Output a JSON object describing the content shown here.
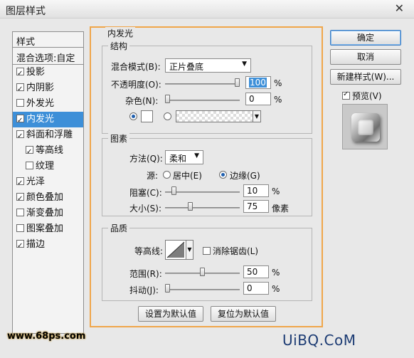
{
  "window": {
    "title": "图层样式"
  },
  "styles": {
    "header": "样式",
    "blend_options": "混合选项:自定",
    "items": [
      {
        "label": "投影",
        "checked": true,
        "sub": false,
        "active": false
      },
      {
        "label": "内阴影",
        "checked": true,
        "sub": false,
        "active": false
      },
      {
        "label": "外发光",
        "checked": false,
        "sub": false,
        "active": false
      },
      {
        "label": "内发光",
        "checked": true,
        "sub": false,
        "active": true
      },
      {
        "label": "斜面和浮雕",
        "checked": true,
        "sub": false,
        "active": false
      },
      {
        "label": "等高线",
        "checked": true,
        "sub": true,
        "active": false
      },
      {
        "label": "纹理",
        "checked": false,
        "sub": true,
        "active": false
      },
      {
        "label": "光泽",
        "checked": true,
        "sub": false,
        "active": false
      },
      {
        "label": "颜色叠加",
        "checked": true,
        "sub": false,
        "active": false
      },
      {
        "label": "渐变叠加",
        "checked": false,
        "sub": false,
        "active": false
      },
      {
        "label": "图案叠加",
        "checked": false,
        "sub": false,
        "active": false
      },
      {
        "label": "描边",
        "checked": true,
        "sub": false,
        "active": false
      }
    ]
  },
  "inner_glow": {
    "section_title": "内发光",
    "structure": {
      "title": "结构",
      "blend_mode_label": "混合模式(B):",
      "blend_mode_value": "正片叠底",
      "opacity_label": "不透明度(O):",
      "opacity_value": "100",
      "opacity_unit": "%",
      "noise_label": "杂色(N):",
      "noise_value": "0",
      "noise_unit": "%"
    },
    "elements": {
      "title": "图素",
      "method_label": "方法(Q):",
      "method_value": "柔和",
      "source_label": "源:",
      "source_center": "居中(E)",
      "source_edge": "边缘(G)",
      "choke_label": "阻塞(C):",
      "choke_value": "10",
      "choke_unit": "%",
      "size_label": "大小(S):",
      "size_value": "75",
      "size_unit": "像素"
    },
    "quality": {
      "title": "品质",
      "contour_label": "等高线:",
      "antialias_label": "消除锯齿(L)",
      "range_label": "范围(R):",
      "range_value": "50",
      "range_unit": "%",
      "jitter_label": "抖动(J):",
      "jitter_value": "0",
      "jitter_unit": "%"
    },
    "make_default": "设置为默认值",
    "reset_default": "复位为默认值"
  },
  "buttons": {
    "ok": "确定",
    "cancel": "取消",
    "new_style": "新建样式(W)...",
    "preview": "预览(V)"
  },
  "watermarks": {
    "left": "www.68ps.com",
    "right": "UiBQ.CoM"
  },
  "colors": {
    "accent": "#3d8fd8",
    "highlight_border": "#f0a64a"
  }
}
